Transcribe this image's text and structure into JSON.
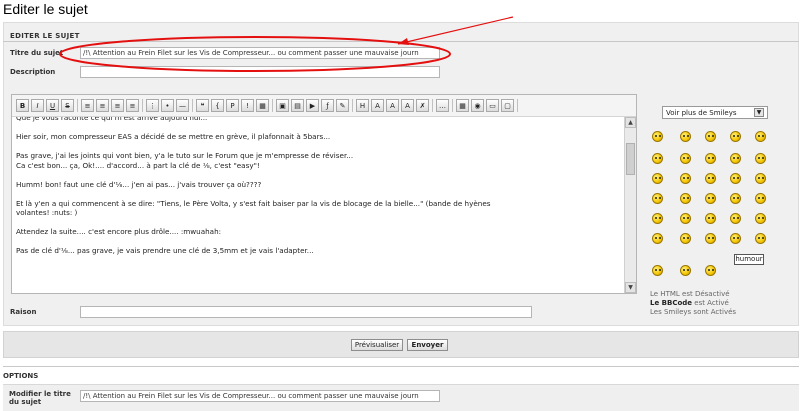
{
  "page": {
    "title": "Editer le sujet"
  },
  "section": {
    "title": "EDITER LE SUJET"
  },
  "form": {
    "subject_label": "Titre du sujet",
    "subject_value": "/!\\ Attention au Frein Filet sur les Vis de Compresseur... ou comment passer une mauvaise journ",
    "description_label": "Description",
    "description_value": "",
    "reason_label": "Raison",
    "reason_value": ""
  },
  "toolbar": {
    "buttons": [
      {
        "name": "bold-button",
        "glyph": "B"
      },
      {
        "name": "italic-button",
        "glyph": "I"
      },
      {
        "name": "underline-button",
        "glyph": "U"
      },
      {
        "name": "strike-button",
        "glyph": "S"
      },
      {
        "name": "align-left-button",
        "glyph": "≡"
      },
      {
        "name": "align-center-button",
        "glyph": "≡"
      },
      {
        "name": "align-right-button",
        "glyph": "≡"
      },
      {
        "name": "justify-button",
        "glyph": "≡"
      },
      {
        "name": "ordered-list-button",
        "glyph": "⋮"
      },
      {
        "name": "bullet-list-button",
        "glyph": "•"
      },
      {
        "name": "horizontal-rule-button",
        "glyph": "—"
      },
      {
        "name": "quote-button",
        "glyph": "❝"
      },
      {
        "name": "code-button",
        "glyph": "{"
      },
      {
        "name": "php-button",
        "glyph": "P"
      },
      {
        "name": "spoiler-button",
        "glyph": "!"
      },
      {
        "name": "table-button",
        "glyph": "▦"
      },
      {
        "name": "image-button",
        "glyph": "▣"
      },
      {
        "name": "media-button",
        "glyph": "▤"
      },
      {
        "name": "youtube-button",
        "glyph": "▶"
      },
      {
        "name": "flash-button",
        "glyph": "ƒ"
      },
      {
        "name": "draw-button",
        "glyph": "✎"
      },
      {
        "name": "heading-button",
        "glyph": "H"
      },
      {
        "name": "font-button",
        "glyph": "A"
      },
      {
        "name": "color-button",
        "glyph": "A"
      },
      {
        "name": "size-button",
        "glyph": "A"
      },
      {
        "name": "remove-format-button",
        "glyph": "✗"
      },
      {
        "name": "more-button",
        "glyph": "…"
      },
      {
        "name": "date-button",
        "glyph": "▦"
      },
      {
        "name": "preview-button",
        "glyph": "◉"
      },
      {
        "name": "source-button",
        "glyph": "▭"
      },
      {
        "name": "paste-button",
        "glyph": "▢"
      }
    ]
  },
  "editor": {
    "paragraphs": [
      "Que je vous raconte ce qui m'est arrivé aujourd'hui...",
      "Hier soir, mon compresseur EAS a décidé de se mettre en grève, il plafonnait à 5bars...",
      "Pas grave, j'ai les joints qui vont bien, y'a le tuto sur le Forum que je m'empresse de réviser...\nCa c'est bon... ça, Ok!.... d'accord... à part la clé de ⅛, c'est \"easy\"!",
      "Humm! bon! faut une clé d'⅛... j'en ai pas... j'vais trouver ça où????",
      "Et là y'en a qui commencent à se dire: \"Tiens, le Père Volta, y s'est fait baiser par la vis de blocage de la bielle...\" (bande de hyènes\nvolantes! :nuts: )",
      "Attendez la suite.... c'est encore plus drôle....   :mwuahah:",
      "Pas de clé d'⅛... pas grave, je vais prendre une clé de 3,5mm et je vais l'adapter..."
    ]
  },
  "smileys": {
    "select_label": "Voir plus de Smileys",
    "humour_label": "humour"
  },
  "side_info": {
    "html_prefix": "Le HTML est ",
    "html_state": "Désactivé",
    "bbcode_name": "Le BBCode",
    "bbcode_state": " est Activé",
    "smileys_text": "Les Smileys sont Activés"
  },
  "submit": {
    "preview_label": "Prévisualiser",
    "send_label": "Envoyer"
  },
  "options": {
    "title": "OPTIONS",
    "modify_title_label_1": "Modifier le titre",
    "modify_title_label_2": "du sujet",
    "modify_title_value": "/!\\ Attention au Frein Filet sur les Vis de Compresseur... ou comment passer une mauvaise journ"
  }
}
